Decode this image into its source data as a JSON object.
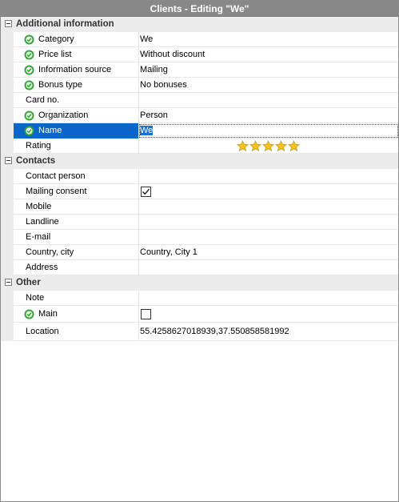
{
  "window": {
    "title": "Clients - Editing \"We\""
  },
  "groups": {
    "additional": "Additional information",
    "contacts": "Contacts",
    "other": "Other"
  },
  "props": {
    "category": {
      "label": "Category",
      "value": "We"
    },
    "price_list": {
      "label": "Price list",
      "value": "Without discount"
    },
    "info_source": {
      "label": "Information source",
      "value": "Mailing"
    },
    "bonus_type": {
      "label": "Bonus type",
      "value": "No bonuses"
    },
    "card_no": {
      "label": "Card no.",
      "value": ""
    },
    "organization": {
      "label": "Organization",
      "value": "Person"
    },
    "name": {
      "label": "Name",
      "value": "We"
    },
    "rating": {
      "label": "Rating",
      "stars": 5
    },
    "contact_person": {
      "label": "Contact person",
      "value": ""
    },
    "mailing_consent": {
      "label": "Mailing consent",
      "checked": true
    },
    "mobile": {
      "label": "Mobile",
      "value": ""
    },
    "landline": {
      "label": "Landline",
      "value": ""
    },
    "email": {
      "label": "E-mail",
      "value": ""
    },
    "country_city": {
      "label": "Country, city",
      "value": "Country, City 1"
    },
    "address": {
      "label": "Address",
      "value": ""
    },
    "note": {
      "label": "Note",
      "value": ""
    },
    "main": {
      "label": "Main",
      "checked": false
    },
    "location": {
      "label": "Location",
      "value": "55.4258627018939,37.550858581992"
    }
  },
  "colors": {
    "accent_selected": "#0a66c8",
    "required_icon": "#2fa82f",
    "star": "#f2c230"
  },
  "icons": {
    "required": "check-circle-icon",
    "collapse": "minus-box-icon",
    "rating": "star-icon",
    "checkbox": "checkbox-icon"
  }
}
